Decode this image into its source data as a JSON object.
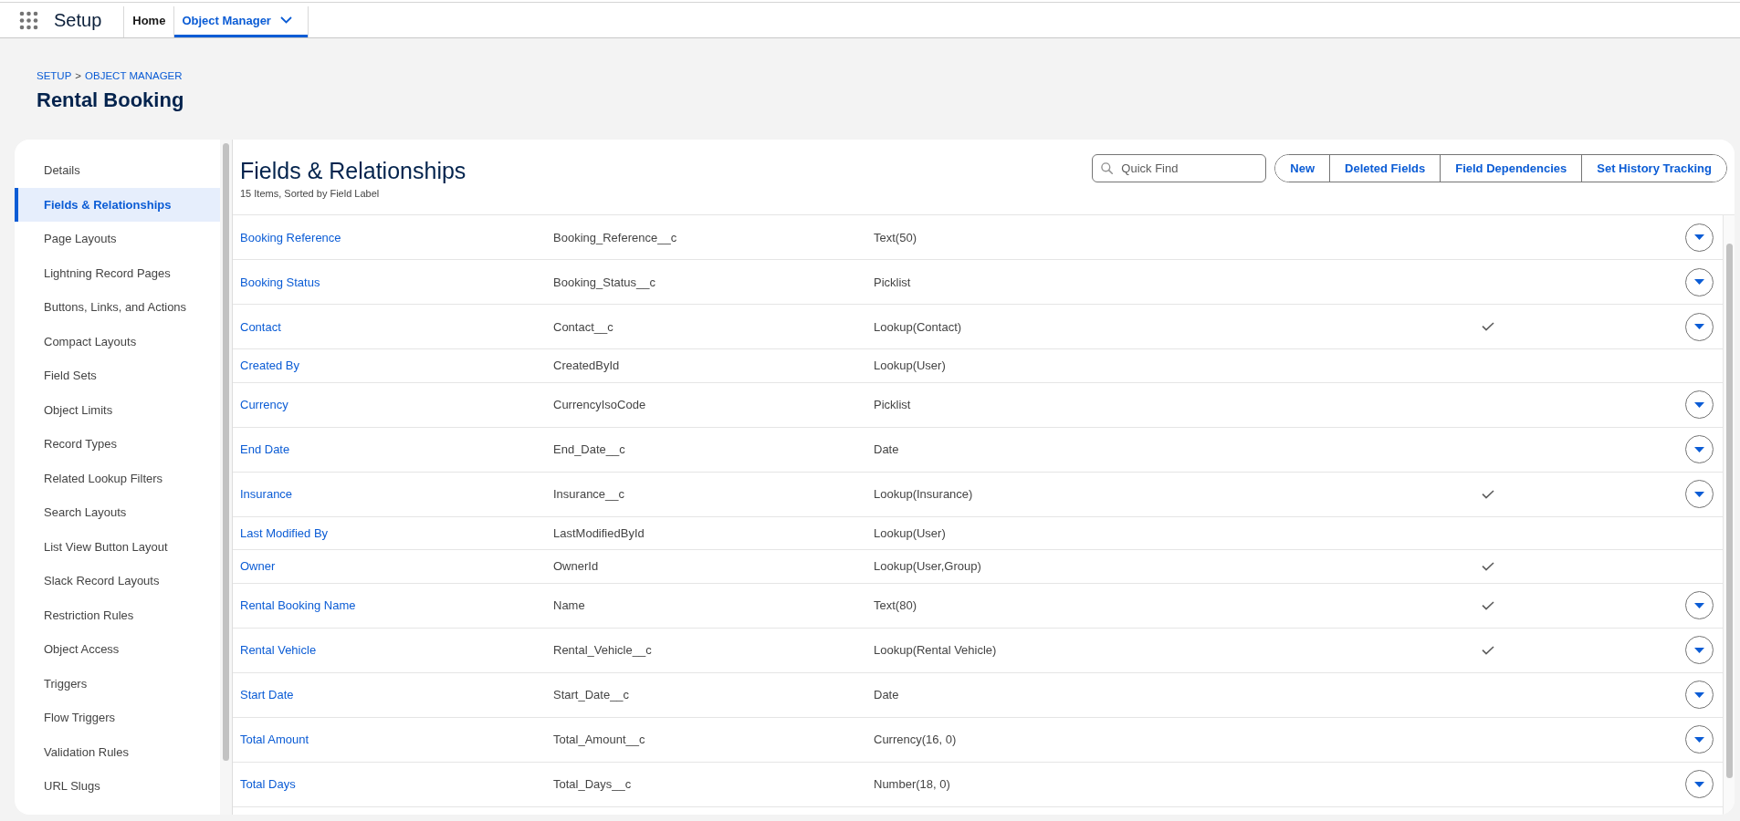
{
  "app_bar": {
    "app_name": "Setup",
    "tabs": [
      {
        "label": "Home",
        "selected": false,
        "dropdown": false
      },
      {
        "label": "Object Manager",
        "selected": true,
        "dropdown": true
      }
    ]
  },
  "page_header": {
    "breadcrumb": [
      "SETUP",
      "OBJECT MANAGER"
    ],
    "breadcrumb_separator": ">",
    "title": "Rental Booking"
  },
  "sidebar": {
    "items": [
      {
        "label": "Details",
        "selected": false
      },
      {
        "label": "Fields & Relationships",
        "selected": true
      },
      {
        "label": "Page Layouts",
        "selected": false
      },
      {
        "label": "Lightning Record Pages",
        "selected": false
      },
      {
        "label": "Buttons, Links, and Actions",
        "selected": false
      },
      {
        "label": "Compact Layouts",
        "selected": false
      },
      {
        "label": "Field Sets",
        "selected": false
      },
      {
        "label": "Object Limits",
        "selected": false
      },
      {
        "label": "Record Types",
        "selected": false
      },
      {
        "label": "Related Lookup Filters",
        "selected": false
      },
      {
        "label": "Search Layouts",
        "selected": false
      },
      {
        "label": "List View Button Layout",
        "selected": false
      },
      {
        "label": "Slack Record Layouts",
        "selected": false
      },
      {
        "label": "Restriction Rules",
        "selected": false
      },
      {
        "label": "Object Access",
        "selected": false
      },
      {
        "label": "Triggers",
        "selected": false
      },
      {
        "label": "Flow Triggers",
        "selected": false
      },
      {
        "label": "Validation Rules",
        "selected": false
      },
      {
        "label": "URL Slugs",
        "selected": false
      }
    ]
  },
  "panel": {
    "title": "Fields & Relationships",
    "subtitle": "15 Items, Sorted by Field Label",
    "search": {
      "placeholder": "Quick Find"
    },
    "buttons": [
      "New",
      "Deleted Fields",
      "Field Dependencies",
      "Set History Tracking"
    ]
  },
  "table": {
    "rows": [
      {
        "column_1": "Booking Reference",
        "column_2": "Booking_Reference__c",
        "column_3": "Text(50)",
        "checked": false,
        "has_menu": true
      },
      {
        "column_1": "Booking Status",
        "column_2": "Booking_Status__c",
        "column_3": "Picklist",
        "checked": false,
        "has_menu": true
      },
      {
        "column_1": "Contact",
        "column_2": "Contact__c",
        "column_3": "Lookup(Contact)",
        "checked": true,
        "has_menu": true
      },
      {
        "column_1": "Created By",
        "column_2": "CreatedById",
        "column_3": "Lookup(User)",
        "checked": false,
        "has_menu": false
      },
      {
        "column_1": "Currency",
        "column_2": "CurrencyIsoCode",
        "column_3": "Picklist",
        "checked": false,
        "has_menu": true
      },
      {
        "column_1": "End Date",
        "column_2": "End_Date__c",
        "column_3": "Date",
        "checked": false,
        "has_menu": true
      },
      {
        "column_1": "Insurance",
        "column_2": "Insurance__c",
        "column_3": "Lookup(Insurance)",
        "checked": true,
        "has_menu": true
      },
      {
        "column_1": "Last Modified By",
        "column_2": "LastModifiedById",
        "column_3": "Lookup(User)",
        "checked": false,
        "has_menu": false
      },
      {
        "column_1": "Owner",
        "column_2": "OwnerId",
        "column_3": "Lookup(User,Group)",
        "checked": true,
        "has_menu": false
      },
      {
        "column_1": "Rental Booking Name",
        "column_2": "Name",
        "column_3": "Text(80)",
        "checked": true,
        "has_menu": true
      },
      {
        "column_1": "Rental Vehicle",
        "column_2": "Rental_Vehicle__c",
        "column_3": "Lookup(Rental Vehicle)",
        "checked": true,
        "has_menu": true
      },
      {
        "column_1": "Start Date",
        "column_2": "Start_Date__c",
        "column_3": "Date",
        "checked": false,
        "has_menu": true
      },
      {
        "column_1": "Total Amount",
        "column_2": "Total_Amount__c",
        "column_3": "Currency(16, 0)",
        "checked": false,
        "has_menu": true
      },
      {
        "column_1": "Total Days",
        "column_2": "Total_Days__c",
        "column_3": "Number(18, 0)",
        "checked": false,
        "has_menu": true
      }
    ]
  }
}
